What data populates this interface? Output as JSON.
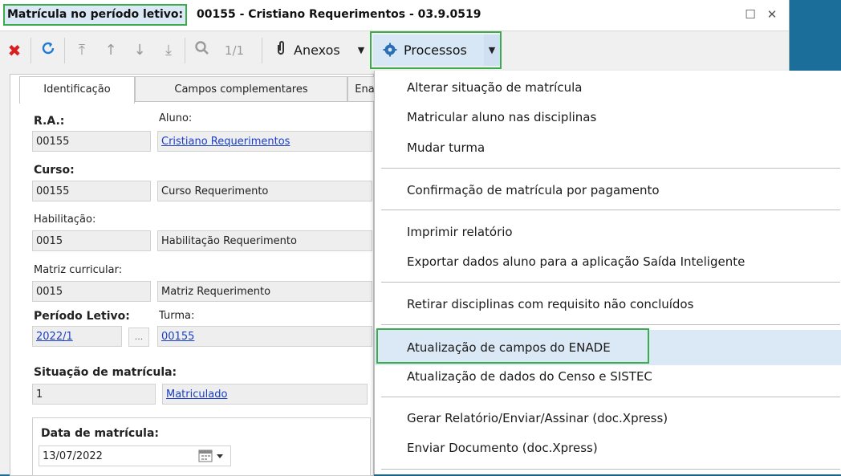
{
  "window": {
    "title_prefix": "Matrícula no período letivo:",
    "title_rest": "00155 - Cristiano Requerimentos - 03.9.0519",
    "maximize_glyph": "☐",
    "close_glyph": "✕"
  },
  "toolbar": {
    "page_indicator": "1/1",
    "anexos_label": "Anexos",
    "processos_label": "Processos"
  },
  "tabs": [
    "Identificação",
    "Campos complementares",
    "Ena"
  ],
  "form": {
    "ra_label": "R.A.:",
    "ra_value": "00155",
    "aluno_label": "Aluno:",
    "aluno_value": "Cristiano Requerimentos",
    "curso_label": "Curso:",
    "curso_code": "00155",
    "curso_name": "Curso Requerimento",
    "habilitacao_label": "Habilitação:",
    "habilitacao_code": "0015",
    "habilitacao_name": "Habilitação Requerimento",
    "matriz_label": "Matriz curricular:",
    "matriz_code": "0015",
    "matriz_name": "Matriz Requerimento",
    "periodo_label": "Período Letivo:",
    "periodo_value": "2022/1",
    "ellipsis": "...",
    "turma_label": "Turma:",
    "turma_value": "00155",
    "situacao_label": "Situação de matrícula:",
    "situacao_code": "1",
    "situacao_value": "Matriculado",
    "data_label": "Data de matrícula:",
    "data_value": "13/07/2022"
  },
  "menu": {
    "items": [
      "Alterar situação de matrícula",
      "Matricular aluno nas disciplinas",
      "Mudar turma",
      "Confirmação de matrícula por pagamento",
      "Imprimir relatório",
      "Exportar dados aluno para a aplicação Saída Inteligente",
      "Retirar disciplinas com requisito não concluídos",
      "Atualização de campos do ENADE",
      "Atualização de dados do Censo e SISTEC",
      "Gerar Relatório/Enviar/Assinar (doc.Xpress)",
      "Enviar Documento (doc.Xpress)"
    ]
  },
  "colors": {
    "highlight_border": "#3cab4c",
    "link": "#1a3fc6",
    "menu_hover": "#dbe8f6",
    "delete_red": "#d92020",
    "refresh_blue": "#1f7ad1"
  }
}
